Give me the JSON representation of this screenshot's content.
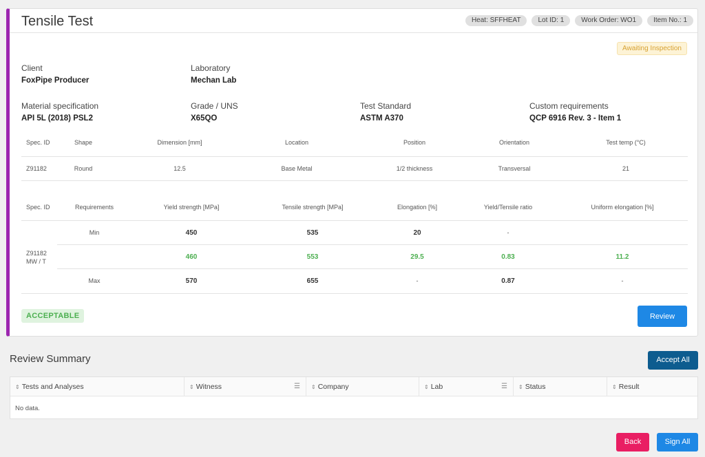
{
  "card": {
    "title": "Tensile Test",
    "chips": [
      "Heat: SFFHEAT",
      "Lot ID: 1",
      "Work Order: WO1",
      "Item No.: 1"
    ],
    "status": "Awaiting Inspection"
  },
  "info": {
    "client": {
      "label": "Client",
      "value": "FoxPipe Producer"
    },
    "laboratory": {
      "label": "Laboratory",
      "value": "Mechan Lab"
    },
    "material": {
      "label": "Material specification",
      "value": "API 5L (2018) PSL2"
    },
    "grade": {
      "label": "Grade / UNS",
      "value": "X65QO"
    },
    "standard": {
      "label": "Test Standard",
      "value": "ASTM A370"
    },
    "custom": {
      "label": "Custom requirements",
      "value": "QCP 6916 Rev. 3 - Item 1"
    }
  },
  "specimen_table": {
    "headers": [
      "Spec. ID",
      "Shape",
      "Dimension [mm]",
      "Location",
      "Position",
      "Orientation",
      "Test temp (°C)"
    ],
    "row": [
      "Z91182",
      "Round",
      "12.5",
      "Base Metal",
      "1/2 thickness",
      "Transversal",
      "21"
    ]
  },
  "results_table": {
    "headers": [
      "Spec. ID",
      "Requirements",
      "Yield strength [MPa]",
      "Tensile strength [MPa]",
      "Elongation [%]",
      "Yield/Tensile ratio",
      "Uniform elongation [%]"
    ],
    "spec_id_line1": "Z91182",
    "spec_id_line2": "MW / T",
    "min": {
      "label": "Min",
      "values": [
        "450",
        "535",
        "20",
        "-",
        ""
      ]
    },
    "actual": {
      "values": [
        "460",
        "553",
        "29.5",
        "0.83",
        "11.2"
      ]
    },
    "max": {
      "label": "Max",
      "values": [
        "570",
        "655",
        "-",
        "0.87",
        "-"
      ]
    }
  },
  "result_badge": "ACCEPTABLE",
  "review_button": "Review",
  "summary": {
    "title": "Review Summary",
    "accept_all": "Accept All",
    "columns": [
      "Tests and Analyses",
      "Witness",
      "Company",
      "Lab",
      "Status",
      "Result"
    ],
    "empty": "No data."
  },
  "footer": {
    "back": "Back",
    "sign_all": "Sign All"
  },
  "colors": {
    "accent": "#9c27b0",
    "primary": "#1e88e5",
    "success": "#4caf50",
    "danger": "#e91e63"
  }
}
